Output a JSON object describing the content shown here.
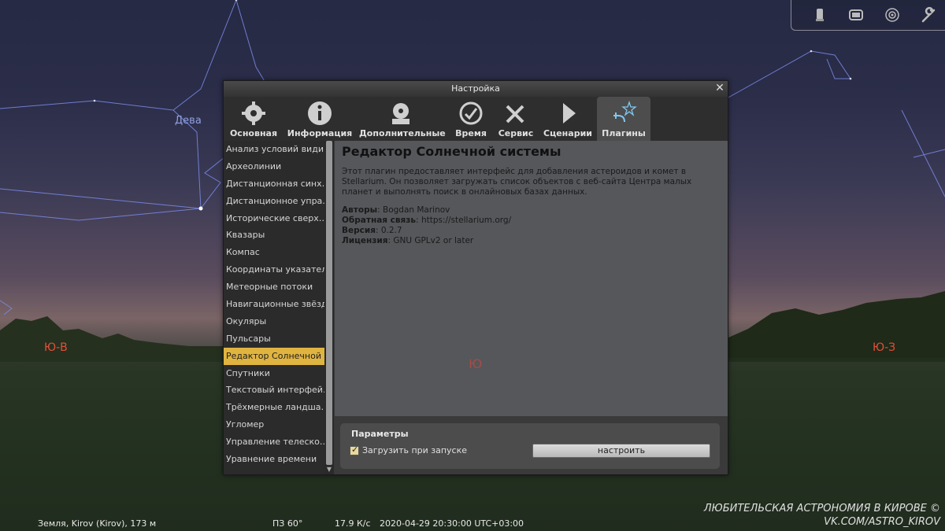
{
  "sky": {
    "labels": {
      "constellation_virgo": "Дева",
      "cardinal_se": "Ю-В",
      "cardinal_sw": "Ю-З",
      "cardinal_s": "Ю"
    }
  },
  "toolbar": {
    "icons": [
      "telescope-icon",
      "window-icon",
      "target-icon",
      "wrench-icon"
    ]
  },
  "dialog": {
    "title": "Настройка",
    "close_symbol": "✕",
    "tabs": [
      {
        "label": "Основная",
        "icon": "gear-icon"
      },
      {
        "label": "Информация",
        "icon": "info-icon"
      },
      {
        "label": "Дополнительные",
        "icon": "extras-icon"
      },
      {
        "label": "Время",
        "icon": "clock-icon"
      },
      {
        "label": "Сервис",
        "icon": "tools-icon"
      },
      {
        "label": "Сценарии",
        "icon": "play-icon"
      },
      {
        "label": "Плагины",
        "icon": "plugin-icon"
      }
    ],
    "active_tab": "Плагины",
    "plugins": [
      "Анализ условий види…",
      "Археолинии",
      "Дистанционная синх…",
      "Дистанционное упра…",
      "Исторические сверх…",
      "Квазары",
      "Компас",
      "Координаты указателя",
      "Метеорные потоки",
      "Навигационные звёзды",
      "Окуляры",
      "Пульсары",
      "Редактор Солнечной …",
      "Спутники",
      "Текстовый интерфей…",
      "Трёхмерные ландша…",
      "Угломер",
      "Управление телеско…",
      "Уравнение времени"
    ],
    "selected_plugin_index": 12,
    "content": {
      "title": "Редактор Солнечной системы",
      "description": "Этот плагин предоставляет интерфейс для добавления астероидов и комет в Stellarium. Он позволяет загружать список объектов с веб-сайта Центра малых планет и выполнять поиск в онлайновых базах данных.",
      "authors_label": "Авторы",
      "authors_value": "Bogdan Marinov",
      "feedback_label": "Обратная связь",
      "feedback_value": "https://stellarium.org/",
      "version_label": "Версия",
      "version_value": "0.2.7",
      "license_label": "Лицензия",
      "license_value": "GNU GPLv2 or later"
    },
    "params": {
      "title": "Параметры",
      "load_at_startup_label": "Загрузить при запуске",
      "load_at_startup_checked": true,
      "configure_button": "настроить"
    }
  },
  "statusbar": {
    "location": "Земля, Kirov (Kirov), 173 м",
    "fov": "ПЗ 60°",
    "fps": "17.9 К/с",
    "datetime": "2020-04-29 20:30:00 UTC+03:00"
  },
  "watermark": {
    "line1": "ЛЮБИТЕЛЬСКАЯ АСТРОНОМИЯ В КИРОВЕ ©",
    "line2": "VK.COM/ASTRO_KIROV"
  },
  "colors": {
    "constellation_lines": "#7b8be8",
    "cardinal": "#e0503a",
    "selected_item": "#e0b440"
  }
}
